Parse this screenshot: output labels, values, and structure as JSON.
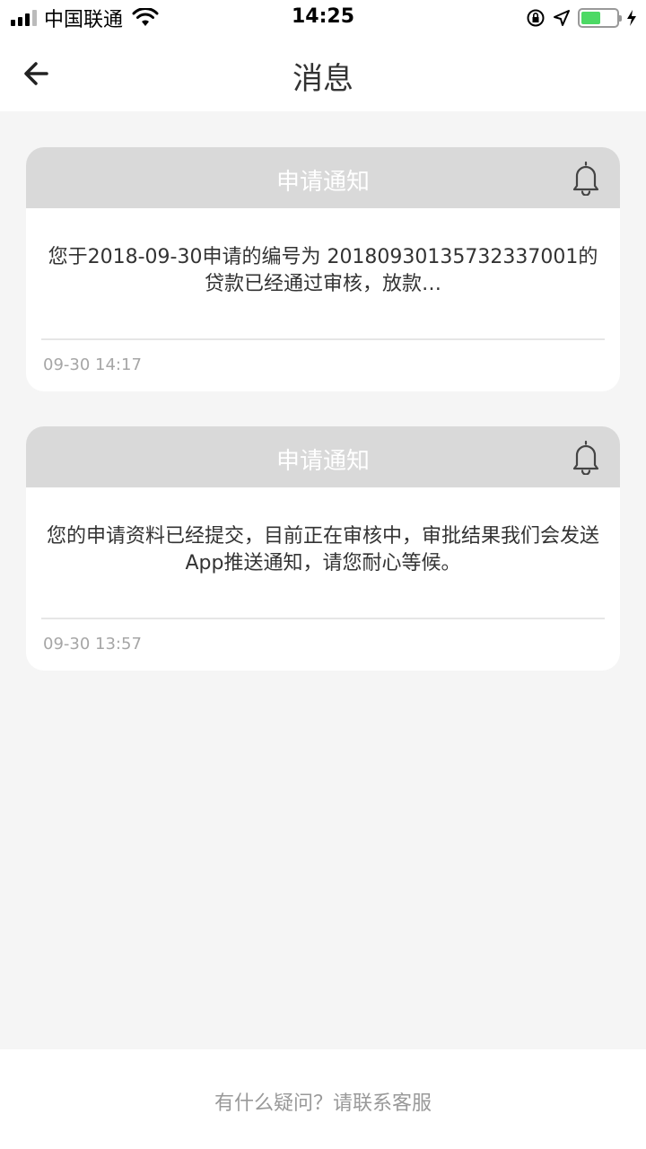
{
  "status_bar": {
    "carrier": "中国联通",
    "time": "14:25",
    "battery_level": 0.55
  },
  "nav": {
    "title": "消息"
  },
  "messages": [
    {
      "title": "申请通知",
      "body": "您于2018-09-30申请的编号为 2018093013573233700​1的贷款已经通过审核，放款…",
      "time": "09-30 14:17"
    },
    {
      "title": "申请通知",
      "body": "您的申请资料已经提交，目前正在审核中，审批结果我们会发送App推送通知，请您耐心等候。",
      "time": "09-30 13:57"
    }
  ],
  "footer": {
    "help_text": "有什么疑问？请联系客服"
  },
  "colors": {
    "card_header_bg": "#d9d9d9",
    "page_bg": "#f5f5f5",
    "battery_green": "#4cd964"
  }
}
